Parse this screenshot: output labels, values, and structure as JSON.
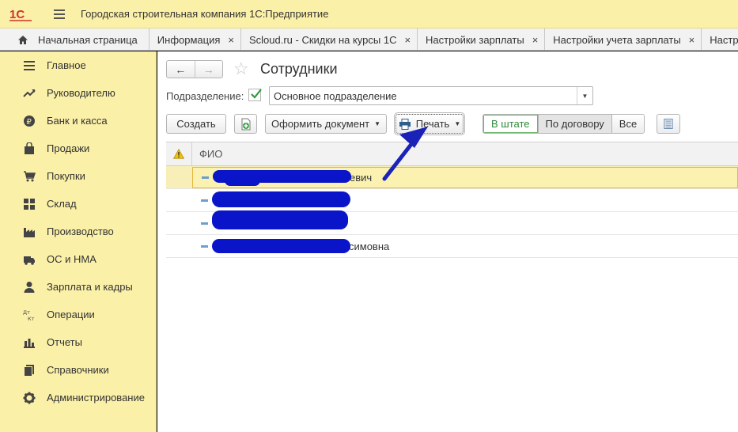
{
  "app": {
    "title": "Городская строительная компания 1С:Предприятие"
  },
  "tabs": [
    {
      "label": "Начальная страница",
      "closable": false
    },
    {
      "label": "Информация",
      "closable": true
    },
    {
      "label": "Scloud.ru - Скидки на курсы 1С",
      "closable": true
    },
    {
      "label": "Настройки зарплаты",
      "closable": true
    },
    {
      "label": "Настройки учета зарплаты",
      "closable": true
    },
    {
      "label": "Настройк",
      "closable": false
    }
  ],
  "close_glyph": "×",
  "sidebar": {
    "items": [
      {
        "label": "Главное",
        "icon": "list-icon"
      },
      {
        "label": "Руководителю",
        "icon": "trend-icon"
      },
      {
        "label": "Банк и касса",
        "icon": "ruble-icon"
      },
      {
        "label": "Продажи",
        "icon": "bag-icon"
      },
      {
        "label": "Покупки",
        "icon": "cart-icon"
      },
      {
        "label": "Склад",
        "icon": "grid-icon"
      },
      {
        "label": "Производство",
        "icon": "factory-icon"
      },
      {
        "label": "ОС и НМА",
        "icon": "truck-icon"
      },
      {
        "label": "Зарплата и кадры",
        "icon": "person-icon"
      },
      {
        "label": "Операции",
        "icon": "dt-kt-icon"
      },
      {
        "label": "Отчеты",
        "icon": "bar-chart-icon"
      },
      {
        "label": "Справочники",
        "icon": "books-icon"
      },
      {
        "label": "Администрирование",
        "icon": "gear-icon"
      }
    ]
  },
  "page": {
    "title": "Сотрудники",
    "back": "←",
    "forward": "→",
    "star": "☆"
  },
  "filter": {
    "label": "Подразделение:",
    "checked": true,
    "value": "Основное подразделение"
  },
  "toolbar": {
    "create": "Создать",
    "issue_document": "Оформить документ",
    "print": "Печать",
    "segments": [
      "В штате",
      "По договору",
      "Все"
    ],
    "active_segment": "В штате"
  },
  "table": {
    "header_fio": "ФИО",
    "rows": [
      {
        "visible_text": "евич",
        "selected": true
      },
      {
        "visible_text": "",
        "selected": false
      },
      {
        "visible_text": "",
        "selected": false
      },
      {
        "visible_text": "симовна",
        "selected": false
      }
    ]
  },
  "colors": {
    "sidebar_bg": "#fbf0a8",
    "accent_green": "#2e8b3a",
    "redaction": "#0a14c8",
    "annotation_arrow": "#1a22b8"
  }
}
